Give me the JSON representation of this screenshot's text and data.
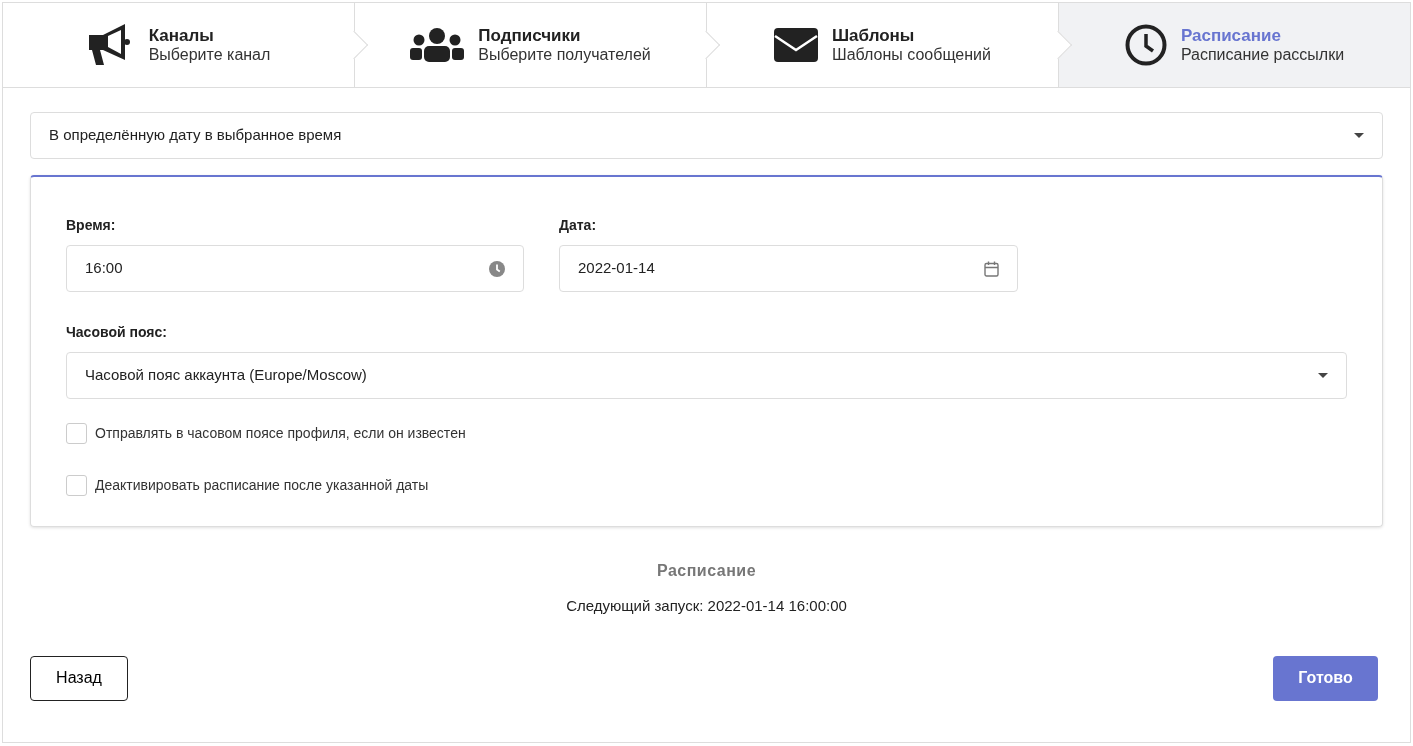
{
  "steps": [
    {
      "kind": "megaphone",
      "title": "Каналы",
      "subtitle": "Выберите канал",
      "selected": false
    },
    {
      "kind": "users",
      "title": "Подписчики",
      "subtitle": "Выберите получателей",
      "selected": false
    },
    {
      "kind": "envelope",
      "title": "Шаблоны",
      "subtitle": "Шаблоны сообщений",
      "selected": false
    },
    {
      "kind": "clock",
      "title": "Расписание",
      "subtitle": "Расписание рассылки",
      "selected": true
    }
  ],
  "schedule_type": {
    "value": "В определённую дату в выбранное время"
  },
  "time": {
    "label": "Время:",
    "value": "16:00"
  },
  "date": {
    "label": "Дата:",
    "value": "2022-01-14"
  },
  "timezone": {
    "label": "Часовой пояс:",
    "value": "Часовой пояс аккаунта (Europe/Moscow)"
  },
  "options": [
    {
      "label": "Отправлять в часовом поясе профиля, если он известен",
      "checked": false
    },
    {
      "label": "Деактивировать расписание после указанной даты",
      "checked": false
    }
  ],
  "summary": {
    "heading": "Расписание",
    "next_run": "Следующий запуск: 2022-01-14 16:00:00"
  },
  "buttons": {
    "back": "Назад",
    "done": "Готово"
  }
}
